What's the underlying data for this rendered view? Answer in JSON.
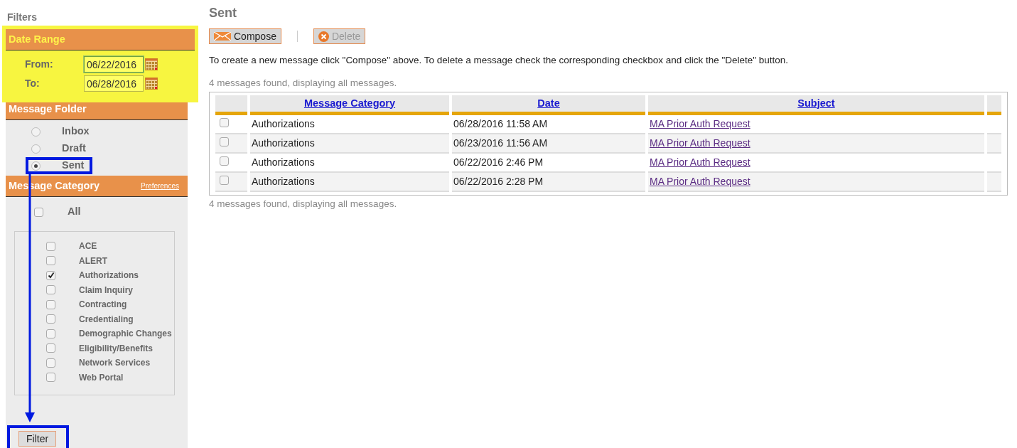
{
  "filters_title": "Filters",
  "date_range": {
    "title": "Date Range",
    "highlighted": true,
    "fields": [
      {
        "label": "From:",
        "value": "06/22/2016",
        "focused": true
      },
      {
        "label": "To:",
        "value": "06/28/2016",
        "focused": false
      }
    ]
  },
  "message_folder": {
    "title": "Message Folder",
    "items": [
      {
        "label": "Inbox",
        "selected": false,
        "outlined": false
      },
      {
        "label": "Draft",
        "selected": false,
        "outlined": false
      },
      {
        "label": "Sent",
        "selected": true,
        "outlined": true
      }
    ]
  },
  "message_category": {
    "title": "Message Category",
    "preferences_link": "Preferences",
    "all": {
      "label": "All",
      "checked": false
    },
    "items": [
      {
        "label": "ACE",
        "checked": false
      },
      {
        "label": "ALERT",
        "checked": false
      },
      {
        "label": "Authorizations",
        "checked": true
      },
      {
        "label": "Claim Inquiry",
        "checked": false
      },
      {
        "label": "Contracting",
        "checked": false
      },
      {
        "label": "Credentialing",
        "checked": false
      },
      {
        "label": "Demographic Changes",
        "checked": false
      },
      {
        "label": "Eligibility/Benefits",
        "checked": false
      },
      {
        "label": "Network Services",
        "checked": false
      },
      {
        "label": "Web Portal",
        "checked": false
      }
    ]
  },
  "filter_button": {
    "label": "Filter",
    "outlined": true
  },
  "pointer_arrow": true,
  "title": "Sent",
  "toolbar": [
    {
      "kind": "compose",
      "label": "Compose",
      "disabled": false
    },
    {
      "kind": "delete",
      "label": "Delete",
      "disabled": true
    }
  ],
  "instructions": "To create a new message click \"Compose\" above. To delete a message check the corresponding checkbox and click the \"Delete\" button.",
  "count_top": "4 messages found, displaying all messages.",
  "table": {
    "columns": [
      "Message Category",
      "Date",
      "Subject"
    ],
    "rows": [
      {
        "checked": false,
        "category": "Authorizations",
        "date": "06/28/2016 11:58 AM",
        "subject": "MA Prior Auth Request"
      },
      {
        "checked": false,
        "category": "Authorizations",
        "date": "06/23/2016 11:56 AM",
        "subject": "MA Prior Auth Request"
      },
      {
        "checked": false,
        "category": "Authorizations",
        "date": "06/22/2016 2:46 PM",
        "subject": "MA Prior Auth Request"
      },
      {
        "checked": false,
        "category": "Authorizations",
        "date": "06/22/2016 2:28 PM",
        "subject": "MA Prior Auth Request"
      }
    ]
  },
  "count_bottom": "4 messages found, displaying all messages."
}
